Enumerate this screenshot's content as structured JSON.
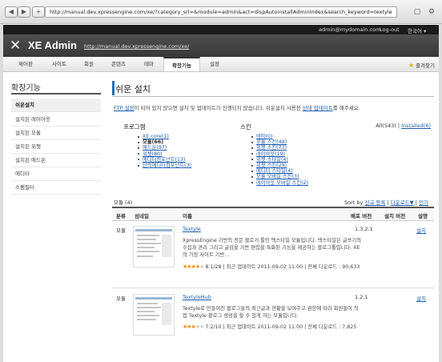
{
  "browser": {
    "back": "◀",
    "forward": "▶",
    "add": "+",
    "url": "http://manual.dev.xpressengine.com/xe/?category_srl=&module=admin&act=dispAutoinstallAdminIndex&search_keyword=textyle"
  },
  "topbar": {
    "email": "admin@mydomain.com",
    "logout": "Log-out",
    "language": "한국어 ▾"
  },
  "header": {
    "logo_mark": "✕",
    "title": "XE Admin",
    "site_link": "http://manual.dev.xpressengine.com/xe/"
  },
  "menu": {
    "items": [
      "제어판",
      "사이트",
      "회원",
      "콘텐츠",
      "테마",
      "확장기능",
      "설정"
    ],
    "favorites": "즐겨찾기",
    "favorites_icon": "star-icon"
  },
  "sidebar": {
    "title": "확장기능",
    "items": [
      "쉬운설치",
      "설치된 레이아웃",
      "설치된 모듈",
      "설치된 위젯",
      "설치된 애드온",
      "에디터",
      "스팸필터"
    ]
  },
  "main": {
    "title": "쉬운 설치",
    "intro_link1": "FTP 설정",
    "intro_text1": "이 되어 있지 않으면 설치 및 업데이트가 진행되지 않습니다. 쉬운설치 사용전 ",
    "intro_link2": "상태 업데이트",
    "intro_text2": "를 해주세요.",
    "categories": {
      "program_heading": "프로그램",
      "skin_heading": "스킨",
      "program_items": [
        "XE core(1)",
        "모듈(66)",
        "애드온(97)",
        "위젯(80)",
        "에디터컴포넌트(13)",
        "단락에디터컴포넌트(3)"
      ],
      "skin_items": [
        "테마(0)",
        "모듈 스킨(49)",
        "위젯 스킨(77)",
        "레이아웃(19)",
        "위젯 스타일(4)",
        "위젯 스킨(29)",
        "에디터 스타일(4)",
        "모듈 모바일 스킨(3)",
        "레이아웃 모바일 스킨(2)"
      ],
      "all_label": "All(543)",
      "installed_link": "Installed(6)"
    },
    "count": "모듈 (4)",
    "sort_label": "Sort by ",
    "sort_new": "신규 등록",
    "sort_download": "다운로드▼",
    "sort_popular": "인기",
    "columns": [
      "분류",
      "섬네일",
      "이름",
      "배포 버전",
      "설치 버전",
      "설명"
    ],
    "rows": [
      {
        "category": "모듈",
        "name": "Textyle",
        "description": "XpressEngine 기반의 전문 블로거 툴인 텍스타일 모듈입니다. 텍스타일은 글쓰기의 수집과 관리 그리고 글감을 기반 편집을 특화된 기능을 제공하는 블로그툴입니다. XE의 가장 사이트 기반...",
        "rating": 4,
        "rating_text": "8.1/28 | 최근 업데이트 2011-09-02 11:00 | 전체 다운로드 : 90,633",
        "version": "1.3.2.1",
        "install_label": "설치"
      },
      {
        "category": "모듈",
        "name": "TextyleHub",
        "description": "Textyle로 만들어진 블로그들의 최근글과 현황을 보여주고 권한에 따라 회원들이 직접 Textyle 블로그 생성을 할 수 있게 하는 모듈입니다.",
        "rating": 3,
        "rating_text": "7.2/10 | 최근 업데이트 2011-09-02 11:00 | 전체 다운로드 : 7,825",
        "version": "1.2.1",
        "install_label": "설치"
      }
    ]
  }
}
